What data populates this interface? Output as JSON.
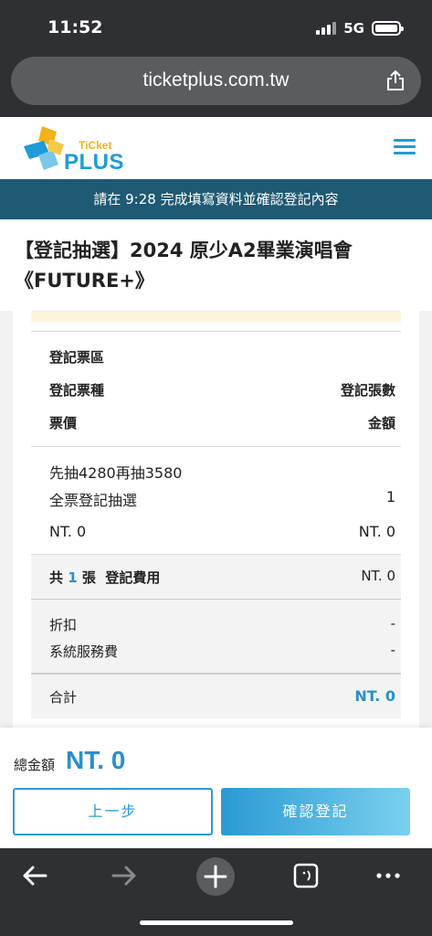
{
  "status_bar": {
    "time": "11:52",
    "network": "5G"
  },
  "browser": {
    "url": "ticketplus.com.tw"
  },
  "site": {
    "logo_small": "TiCket",
    "logo_big": "PLUS"
  },
  "timer_notice": "請在 9:28 完成填寫資料並確認登記內容",
  "event": {
    "title_line1": "【登記抽選】2024 原少A2畢業演唱會",
    "title_line2": "《FUTURE+》"
  },
  "summary": {
    "header": {
      "zone_label": "登記票區",
      "type_label": "登記票種",
      "count_label": "登記張數",
      "price_label": "票價",
      "amount_label": "金額"
    },
    "item": {
      "zone": "先抽4280再抽3580",
      "type": "全票登記抽選",
      "count": "1",
      "price": "NT. 0",
      "amount": "NT. 0"
    },
    "count_row": {
      "prefix": "共",
      "count": "1",
      "suffix": "張  登記費用",
      "fee": "NT. 0"
    },
    "discount": {
      "label": "折扣",
      "value": "-"
    },
    "service_fee": {
      "label": "系統服務費",
      "value": "-"
    },
    "subtotal": {
      "label": "合計",
      "value": "NT. 0"
    }
  },
  "total": {
    "label": "總金額",
    "value": "NT. 0"
  },
  "buttons": {
    "back": "上一步",
    "confirm": "確認登記"
  },
  "colors": {
    "accent": "#2a8fcb",
    "header_bar": "#1e5a73",
    "chrome": "#2f3033"
  }
}
